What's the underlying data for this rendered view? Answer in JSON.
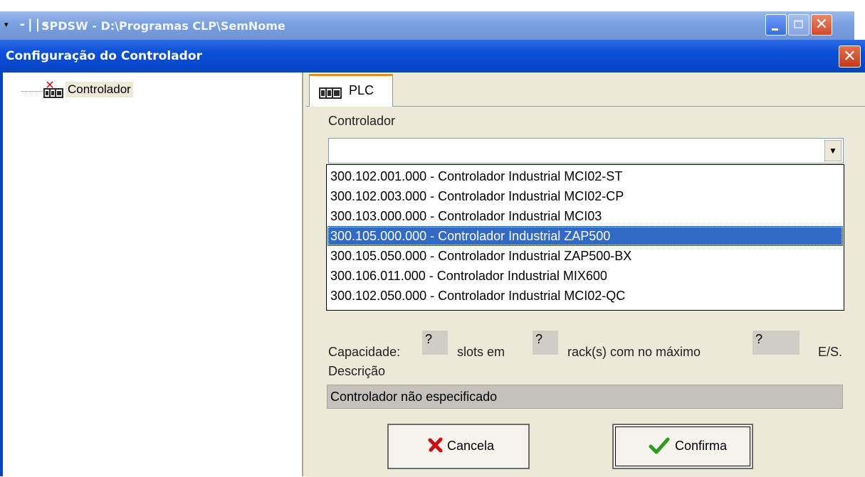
{
  "app": {
    "menu_glyph": "▾",
    "symbol": "-||-",
    "title": "SPDSW - D:\\Programas CLP\\SemNome",
    "close_glyph": "✕"
  },
  "dialog": {
    "title": "Configuração do Controlador",
    "close_glyph": "✕"
  },
  "tree": {
    "root_label": "Controlador"
  },
  "tabs": [
    {
      "label": "PLC"
    }
  ],
  "panel": {
    "controller_label": "Controlador",
    "combo_value": "",
    "combo_arrow": "▼",
    "options": [
      "300.102.001.000 - Controlador Industrial MCI02-ST",
      "300.102.003.000 - Controlador Industrial MCI02-CP",
      "300.103.000.000 - Controlador Industrial MCI03",
      "300.105.000.000 - Controlador Industrial ZAP500",
      "300.105.050.000 - Controlador Industrial ZAP500-BX",
      "300.106.011.000 - Controlador Industrial MIX600",
      "300.102.050.000 - Controlador Industrial MCI02-QC"
    ],
    "selected_option": "300.105.000.000 - Controlador Industrial ZAP500",
    "capacity_label": "Capacidade:",
    "slots_value": "?",
    "slots_text": "slots em",
    "racks_value": "?",
    "racks_text": "rack(s) com no máximo",
    "io_value": "?",
    "io_text": "E/S.",
    "description_label": "Descrição",
    "description_value": "Controlador não especificado"
  },
  "buttons": {
    "cancel_label": "Cancela",
    "confirm_label": "Confirma"
  },
  "colors": {
    "dialog_titlebar": "#0a4fd8",
    "selection": "#316ac5",
    "panel_bg": "#ece9d8"
  }
}
